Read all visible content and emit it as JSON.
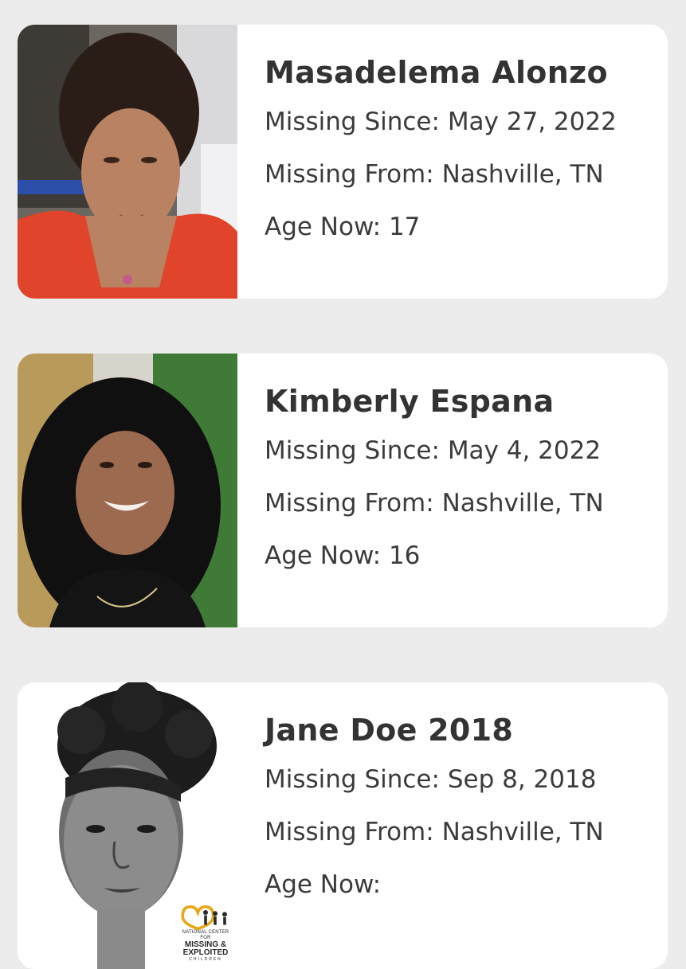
{
  "cases": [
    {
      "name": "Masadelema Alonzo",
      "missing_since_label": "Missing Since:",
      "missing_since": "May 27, 2022",
      "missing_from_label": "Missing From:",
      "missing_from": "Nashville, TN",
      "age_now_label": "Age Now:",
      "age_now": "17",
      "photo_type": "photograph"
    },
    {
      "name": "Kimberly Espana",
      "missing_since_label": "Missing Since:",
      "missing_since": "May 4, 2022",
      "missing_from_label": "Missing From:",
      "missing_from": "Nashville, TN",
      "age_now_label": "Age Now:",
      "age_now": "16",
      "photo_type": "photograph"
    },
    {
      "name": "Jane Doe 2018",
      "missing_since_label": "Missing Since:",
      "missing_since": "Sep 8, 2018",
      "missing_from_label": "Missing From:",
      "missing_from": "Nashville, TN",
      "age_now_label": "Age Now:",
      "age_now": "",
      "photo_type": "forensic-sketch",
      "logo": {
        "line1": "NATIONAL CENTER FOR",
        "line2": "MISSING &",
        "line3": "EXPLOITED",
        "line4": "CHILDREN"
      }
    }
  ],
  "colors": {
    "background": "#ececec",
    "card": "#ffffff",
    "text": "#3b3b3b",
    "logo_accent": "#e6a817"
  }
}
